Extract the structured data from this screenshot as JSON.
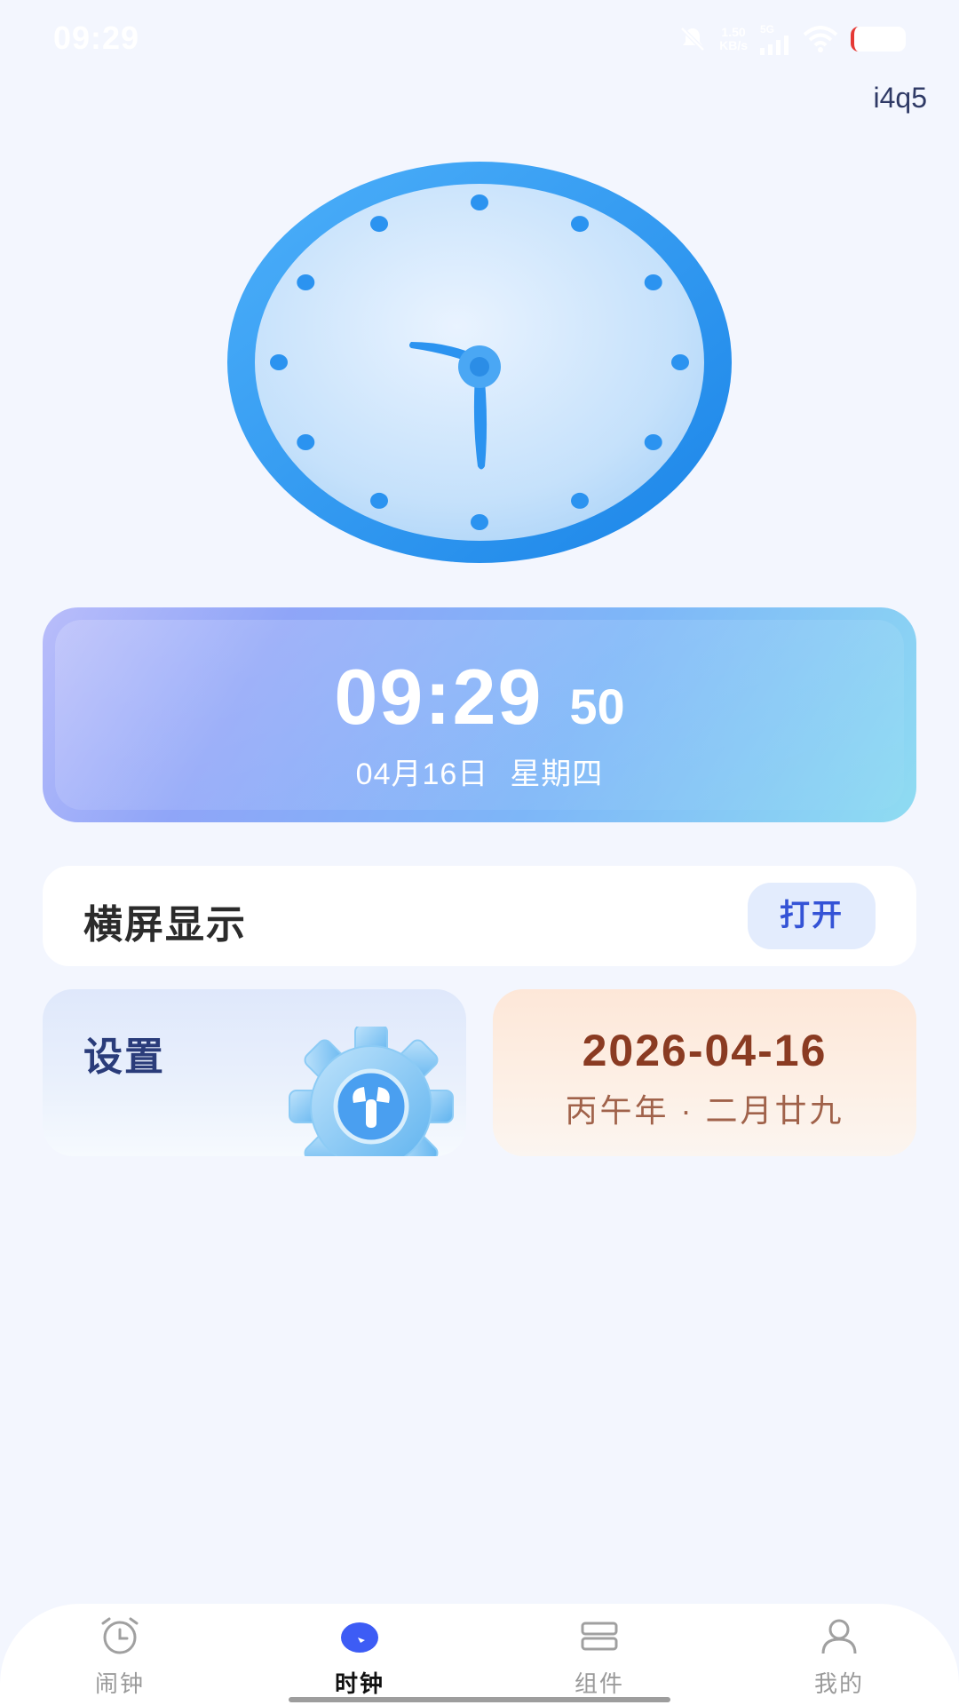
{
  "status_bar": {
    "time": "09:29",
    "net_speed_value": "1.50",
    "net_speed_unit": "KB/s",
    "signal_label": "5G",
    "icons": [
      "mute-icon",
      "signal-icon",
      "wifi-icon",
      "battery-icon"
    ]
  },
  "top_tag": "i4q5",
  "analog_clock": {
    "hour": 9,
    "minute": 29
  },
  "time_card": {
    "hm": "09:29",
    "seconds": "50",
    "date": "04月16日",
    "weekday": "星期四"
  },
  "landscape": {
    "label": "横屏显示",
    "button": "打开"
  },
  "settings_card": {
    "label": "设置"
  },
  "calendar_card": {
    "date": "2026-04-16",
    "lunar": "丙午年 · 二月廿九"
  },
  "bottom_nav": {
    "items": [
      {
        "label": "闹钟",
        "icon": "alarm-clock-icon",
        "active": false
      },
      {
        "label": "时钟",
        "icon": "clock-icon",
        "active": true
      },
      {
        "label": "组件",
        "icon": "widgets-icon",
        "active": false
      },
      {
        "label": "我的",
        "icon": "profile-icon",
        "active": false
      }
    ]
  },
  "colors": {
    "accent": "#3d5cf5",
    "clock_ring": "#2b93f0",
    "calendar_text": "#8a3b22"
  }
}
